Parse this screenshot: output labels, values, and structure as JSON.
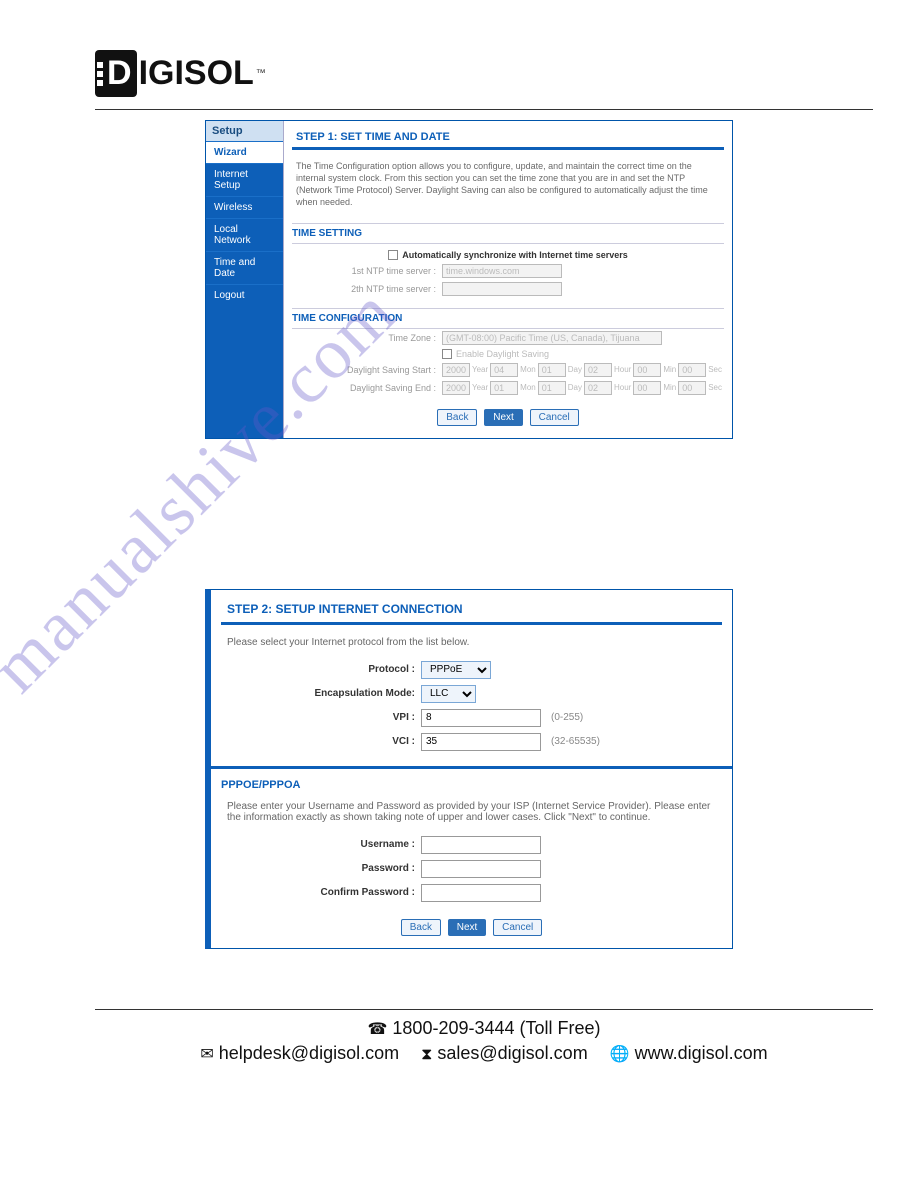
{
  "logo": {
    "part1": "D",
    "part2": "IGISOL",
    "tm": "™"
  },
  "screenshot1": {
    "sidebar_head": "Setup",
    "sidebar_items": [
      "Wizard",
      "Internet Setup",
      "Wireless",
      "Local Network",
      "Time and Date",
      "Logout"
    ],
    "step_title": "STEP 1: SET TIME AND DATE",
    "description": "The Time Configuration option allows you to configure, update, and maintain the correct time on the internal system clock. From this section you can set the time zone that you are in and set the NTP (Network Time Protocol) Server. Daylight Saving can also be configured to automatically adjust the time when needed.",
    "time_setting_hdr": "TIME SETTING",
    "auto_sync_label": "Automatically synchronize with Internet time servers",
    "ntp1_label": "1st NTP time server :",
    "ntp1_value": "time.windows.com",
    "ntp2_label": "2th NTP time server :",
    "ntp2_value": "",
    "time_config_hdr": "TIME CONFIGURATION",
    "tz_label": "Time Zone :",
    "tz_value": "(GMT-08:00) Pacific Time (US, Canada), Tijuana",
    "eds_label": "Enable Daylight Saving",
    "dss_label": "Daylight Saving Start :",
    "dse_label": "Daylight Saving End :",
    "ds": {
      "start": {
        "year": "2000",
        "mon": "04",
        "day": "01",
        "hour": "02",
        "min": "00",
        "sec": "00"
      },
      "end": {
        "year": "2000",
        "mon": "01",
        "day": "01",
        "hour": "02",
        "min": "00",
        "sec": "00"
      }
    },
    "unit": {
      "year": "Year",
      "mon": "Mon",
      "day": "Day",
      "hour": "Hour",
      "min": "Min",
      "sec": "Sec"
    },
    "buttons": {
      "back": "Back",
      "next": "Next",
      "cancel": "Cancel"
    }
  },
  "screenshot2": {
    "step_title": "STEP 2: SETUP INTERNET CONNECTION",
    "description": "Please select your Internet protocol from the list below.",
    "protocol_label": "Protocol :",
    "protocol_value": "PPPoE",
    "encap_label": "Encapsulation Mode:",
    "encap_value": "LLC",
    "vpi_label": "VPI :",
    "vpi_value": "8",
    "vpi_hint": "(0-255)",
    "vci_label": "VCI :",
    "vci_value": "35",
    "vci_hint": "(32-65535)",
    "sub_hdr": "PPPOE/PPPOA",
    "sub_desc": "Please enter your Username and Password as provided by your ISP (Internet Service Provider). Please enter the information exactly as shown taking note of upper and lower cases. Click \"Next\" to continue.",
    "username_label": "Username :",
    "password_label": "Password :",
    "confirm_label": "Confirm Password :",
    "buttons": {
      "back": "Back",
      "next": "Next",
      "cancel": "Cancel"
    }
  },
  "footer": {
    "phone": "1800-209-3444 (Toll Free)",
    "helpdesk": "helpdesk@digisol.com",
    "sales": "sales@digisol.com",
    "web": "www.digisol.com"
  },
  "watermark": "manualshive.com"
}
